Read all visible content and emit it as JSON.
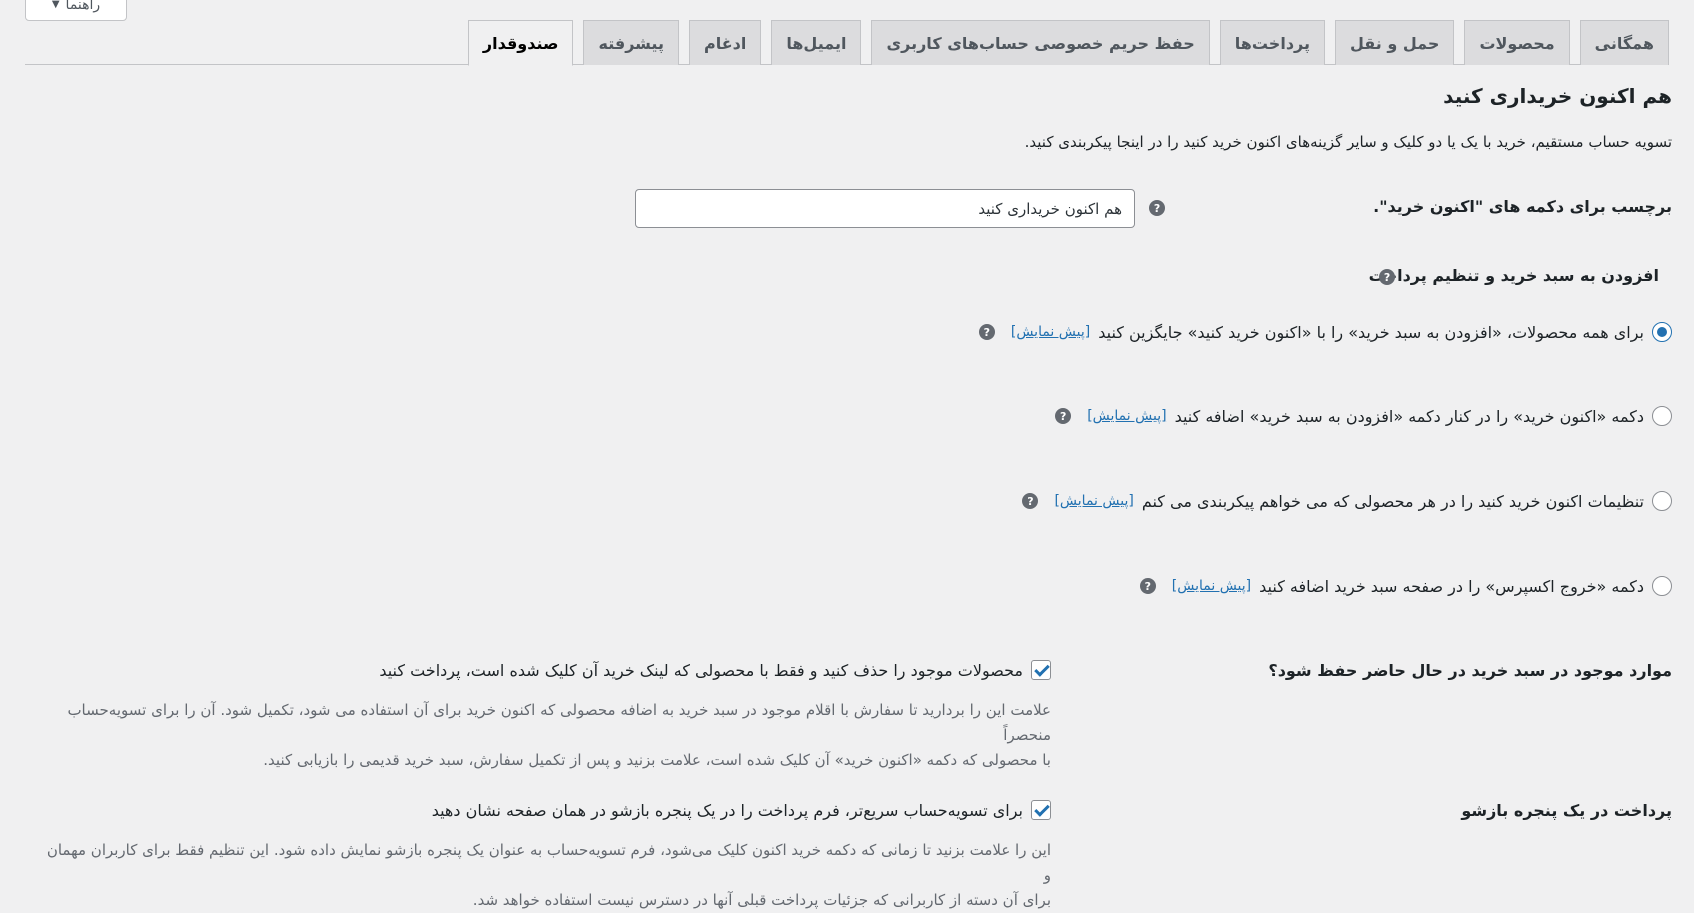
{
  "help_button": {
    "label": "راهنما",
    "caret": "▼"
  },
  "tabs": [
    {
      "label": "همگانی",
      "active": false
    },
    {
      "label": "محصولات",
      "active": false
    },
    {
      "label": "حمل و نقل",
      "active": false
    },
    {
      "label": "پرداخت‌ها",
      "active": false
    },
    {
      "label": "حفظ حریم خصوصی حساب‌های کاربری",
      "active": false
    },
    {
      "label": "ایمیل‌ها",
      "active": false
    },
    {
      "label": "ادغام",
      "active": false
    },
    {
      "label": "پیشرفته",
      "active": false
    },
    {
      "label": "صندوقدار",
      "active": true
    }
  ],
  "section": {
    "title": "هم اکنون خریداری کنید",
    "description": "تسویه حساب مستقیم، خرید با یک یا دو کلیک و سایر گزینه‌های اکنون خرید کنید را در اینجا پیکربندی کنید."
  },
  "button_label_field": {
    "label": "برچسب برای دکمه های \"اکنون خرید\".",
    "value": "هم اکنون خریداری کنید",
    "help_glyph": "?"
  },
  "cart_checkout": {
    "label": "افزودن به سبد خرید و تنظیم پرداخت",
    "help_glyph": "?",
    "preview_label": "[پیش نمایش]",
    "options": [
      {
        "text": "برای همه محصولات، «افزودن به سبد خرید» را با «اکنون خرید کنید» جایگزین کنید",
        "checked": true
      },
      {
        "text": "دکمه «اکنون خرید» را در کنار دکمه «افزودن به سبد خرید» اضافه کنید",
        "checked": false
      },
      {
        "text": "تنظیمات اکنون خرید کنید را در هر محصولی که می خواهم پیکربندی می کنم",
        "checked": false
      },
      {
        "text": "دکمه «خروج اکسپرس» را در صفحه سبد خرید اضافه کنید",
        "checked": false
      }
    ]
  },
  "keep_cart": {
    "label": "موارد موجود در سبد خرید در حال حاضر حفظ شود؟",
    "checkbox_text": "محصولات موجود را حذف کنید و فقط با محصولی که لینک خرید آن کلیک شده است، پرداخت کنید",
    "checked": true,
    "help_line1": "علامت این را بردارید تا سفارش با اقلام موجود در سبد خرید به اضافه محصولی که اکنون خرید برای آن استفاده می شود، تکمیل شود. آن را برای تسویه‌حساب منحصراً",
    "help_line2": "با محصولی که دکمه «اکنون خرید» آن کلیک شده است، علامت بزنید و پس از تکمیل سفارش، سبد خرید قدیمی را بازیابی کنید."
  },
  "popup_checkout": {
    "label": "پرداخت در یک پنجره بازشو",
    "checkbox_text": "برای تسویه‌حساب سریع‌تر، فرم پرداخت را در یک پنجره بازشو در همان صفحه نشان دهید",
    "checked": true,
    "help_line1": "این را علامت بزنید تا زمانی که دکمه خرید اکنون کلیک می‌شود، فرم تسویه‌حساب به عنوان یک پنجره بازشو نمایش داده شود. این تنظیم فقط برای کاربران مهمان و",
    "help_line2": "برای آن دسته از کاربرانی که جزئیات پرداخت قبلی آنها در دسترس نیست استفاده خواهد شد."
  }
}
